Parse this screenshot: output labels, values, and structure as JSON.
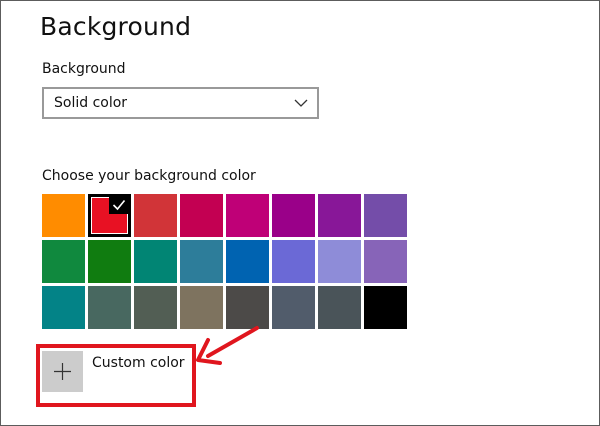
{
  "page": {
    "title": "Background"
  },
  "background_setting": {
    "label": "Background",
    "selected_value": "Solid color",
    "icon": "chevron-down-icon"
  },
  "color_picker": {
    "label": "Choose your background color",
    "selected_index": 1,
    "swatches": [
      "#ff8c00",
      "#e81123",
      "#d13438",
      "#c30052",
      "#bf0077",
      "#9a0089",
      "#881798",
      "#744da9",
      "#10893e",
      "#107c10",
      "#018574",
      "#2d7d9a",
      "#0063b1",
      "#6b69d6",
      "#8e8cd8",
      "#8764b8",
      "#038387",
      "#486860",
      "#525e54",
      "#7e735f",
      "#4c4a48",
      "#515c6b",
      "#4a5459",
      "#000000"
    ],
    "selected_icon": "checkmark-icon"
  },
  "custom_color": {
    "label": "Custom color",
    "icon": "plus-icon"
  },
  "annotation": {
    "highlight_color": "#e0161e"
  }
}
